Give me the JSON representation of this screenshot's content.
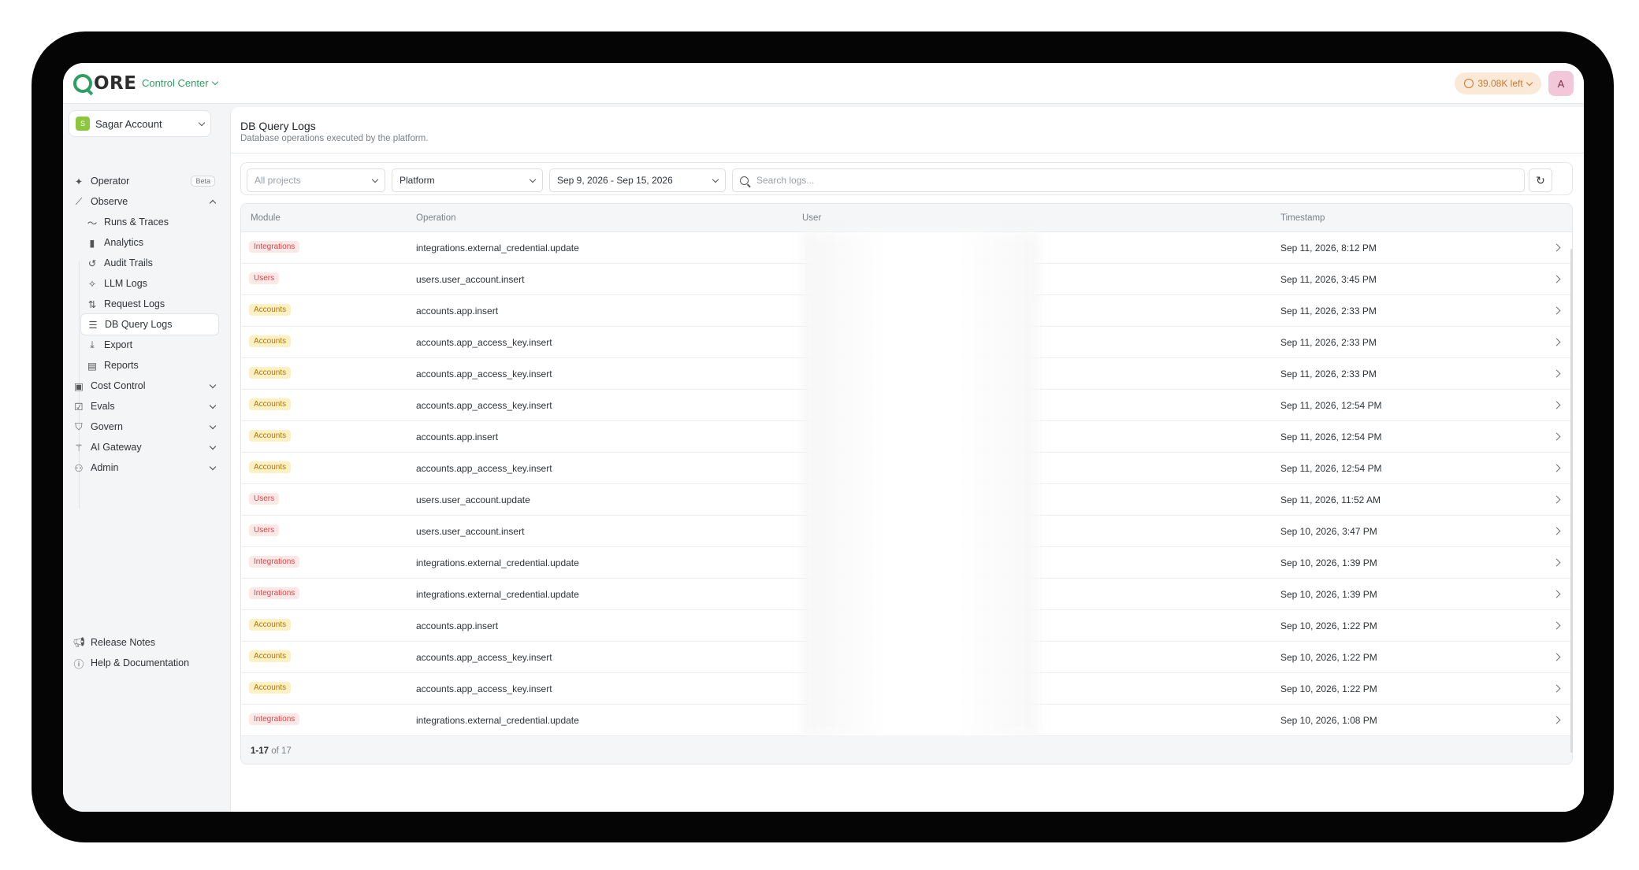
{
  "topbar": {
    "logo_text": "ORE",
    "app_switcher": "Control Center",
    "credits": "39.08K left",
    "avatar": "A"
  },
  "colors": {
    "brand": "#2e9e63",
    "accent_warm": "#c77832"
  },
  "sidebar": {
    "account": {
      "initial": "S",
      "name": "Sagar Account"
    },
    "items": [
      {
        "label": "Operator",
        "badge": "Beta",
        "icon": "sparkle-icon"
      },
      {
        "label": "Observe",
        "icon": "chart-icon",
        "expanded": true
      },
      {
        "label": "Runs & Traces",
        "icon": "pulse-icon"
      },
      {
        "label": "Analytics",
        "icon": "bar-chart-icon"
      },
      {
        "label": "Audit Trails",
        "icon": "history-icon"
      },
      {
        "label": "LLM Logs",
        "icon": "sparkle-icon"
      },
      {
        "label": "Request Logs",
        "icon": "arrows-updown-icon"
      },
      {
        "label": "DB Query Logs",
        "icon": "database-icon",
        "active": true
      },
      {
        "label": "Export",
        "icon": "download-icon"
      },
      {
        "label": "Reports",
        "icon": "document-icon"
      },
      {
        "label": "Cost Control",
        "icon": "wallet-icon"
      },
      {
        "label": "Evals",
        "icon": "clipboard-check-icon"
      },
      {
        "label": "Govern",
        "icon": "shield-icon"
      },
      {
        "label": "AI Gateway",
        "icon": "wand-icon"
      },
      {
        "label": "Admin",
        "icon": "users-icon"
      }
    ],
    "footer": [
      {
        "label": "Release Notes",
        "icon": "megaphone-icon"
      },
      {
        "label": "Help & Documentation",
        "icon": "help-circle-icon"
      }
    ]
  },
  "page": {
    "title": "DB Query Logs",
    "subtitle": "Database operations executed by the platform."
  },
  "filters": {
    "project": "All projects",
    "platform": "Platform",
    "date_range": "Sep 9, 2026 - Sep 15, 2026",
    "search_placeholder": "Search logs..."
  },
  "table": {
    "columns": [
      "Module",
      "Operation",
      "User",
      "Timestamp"
    ],
    "rows": [
      {
        "module": "Integrations",
        "operation": "integrations.external_credential.update",
        "timestamp": "Sep 11, 2026, 8:12 PM"
      },
      {
        "module": "Users",
        "operation": "users.user_account.insert",
        "timestamp": "Sep 11, 2026, 3:45 PM"
      },
      {
        "module": "Accounts",
        "operation": "accounts.app.insert",
        "timestamp": "Sep 11, 2026, 2:33 PM"
      },
      {
        "module": "Accounts",
        "operation": "accounts.app_access_key.insert",
        "timestamp": "Sep 11, 2026, 2:33 PM"
      },
      {
        "module": "Accounts",
        "operation": "accounts.app_access_key.insert",
        "timestamp": "Sep 11, 2026, 2:33 PM"
      },
      {
        "module": "Accounts",
        "operation": "accounts.app_access_key.insert",
        "timestamp": "Sep 11, 2026, 12:54 PM"
      },
      {
        "module": "Accounts",
        "operation": "accounts.app.insert",
        "timestamp": "Sep 11, 2026, 12:54 PM"
      },
      {
        "module": "Accounts",
        "operation": "accounts.app_access_key.insert",
        "timestamp": "Sep 11, 2026, 12:54 PM"
      },
      {
        "module": "Users",
        "operation": "users.user_account.update",
        "timestamp": "Sep 11, 2026, 11:52 AM"
      },
      {
        "module": "Users",
        "operation": "users.user_account.insert",
        "timestamp": "Sep 10, 2026, 3:47 PM"
      },
      {
        "module": "Integrations",
        "operation": "integrations.external_credential.update",
        "timestamp": "Sep 10, 2026, 1:39 PM"
      },
      {
        "module": "Integrations",
        "operation": "integrations.external_credential.update",
        "timestamp": "Sep 10, 2026, 1:39 PM"
      },
      {
        "module": "Accounts",
        "operation": "accounts.app.insert",
        "timestamp": "Sep 10, 2026, 1:22 PM"
      },
      {
        "module": "Accounts",
        "operation": "accounts.app_access_key.insert",
        "timestamp": "Sep 10, 2026, 1:22 PM"
      },
      {
        "module": "Accounts",
        "operation": "accounts.app_access_key.insert",
        "timestamp": "Sep 10, 2026, 1:22 PM"
      },
      {
        "module": "Integrations",
        "operation": "integrations.external_credential.update",
        "timestamp": "Sep 10, 2026, 1:08 PM"
      }
    ],
    "pagination": {
      "range": "1-17",
      "of_label": "of 17"
    }
  }
}
